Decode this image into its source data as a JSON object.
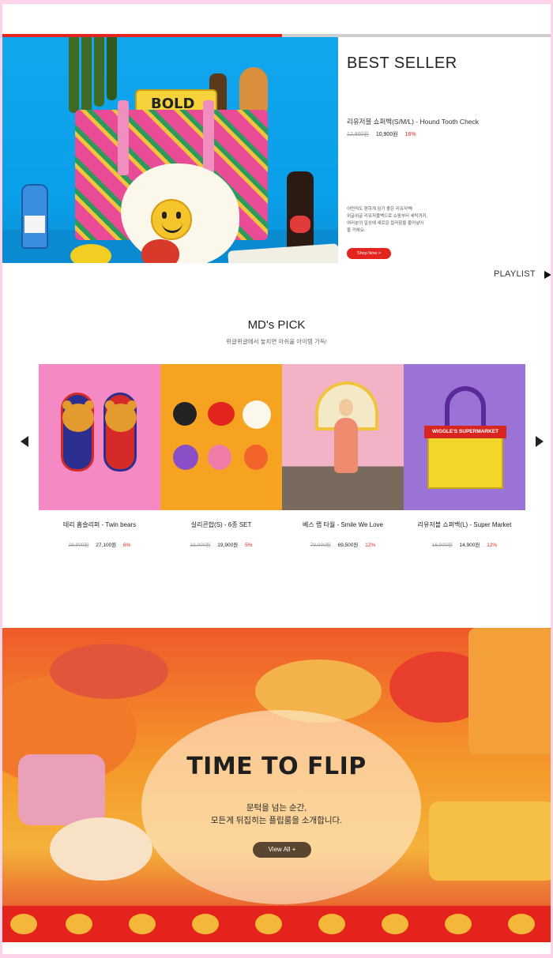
{
  "best_seller": {
    "title": "BEST SELLER",
    "progress": 0.51,
    "product_name": "리유저블 쇼퍼백(S/M/L) - Hound Tooth Check",
    "original_price": "12,900원",
    "sale_price": "10,900원",
    "discount": "16%",
    "description": [
      "어떤적도 편하게 담기 좋은 리유저백!",
      "위글위글 리유저블백으로 쇼핑부터 세탁까지,",
      "여러분의 일상에 새로운 컬러함을 불어넣어",
      "줄 거에요."
    ],
    "shop_button": "Shop Now >",
    "playlist_label": "PLAYLIST",
    "image_text": "BOLD",
    "accent_color": "#e3241f"
  },
  "md_pick": {
    "title": "MD's PICK",
    "subtitle": "위글위글에서 놓치면 아쉬울 아이템 가득!",
    "products": [
      {
        "name": "테리 홈슬리퍼 - Twin bears",
        "original_price": "28,900원",
        "sale_price": "27,100원",
        "discount": "6%",
        "bg": "#f589c3"
      },
      {
        "name": "실리콘합(S) - 6종 SET",
        "original_price": "21,000원",
        "sale_price": "19,900원",
        "discount": "5%",
        "bg": "#f6a322"
      },
      {
        "name": "베스 랩 타월 - Smile We Love",
        "original_price": "79,000원",
        "sale_price": "69,500원",
        "discount": "12%",
        "bg": "#f2a8c0"
      },
      {
        "name": "리유저블 쇼퍼백(L) - Super Market",
        "original_price": "16,900원",
        "sale_price": "14,900원",
        "discount": "12%",
        "bg": "#9b72d6"
      }
    ],
    "tote_banner": "WIGGLE'S SUPERMARKET"
  },
  "time_to_flip": {
    "title": "TIME TO FLIP",
    "line1": "문턱을 넘는 순간,",
    "line2": "모든게 뒤집히는 플립룸을 소개합니다.",
    "button": "View All +"
  },
  "colors": {
    "page_border": "#fcd3e8",
    "sale_red": "#e3241f"
  }
}
